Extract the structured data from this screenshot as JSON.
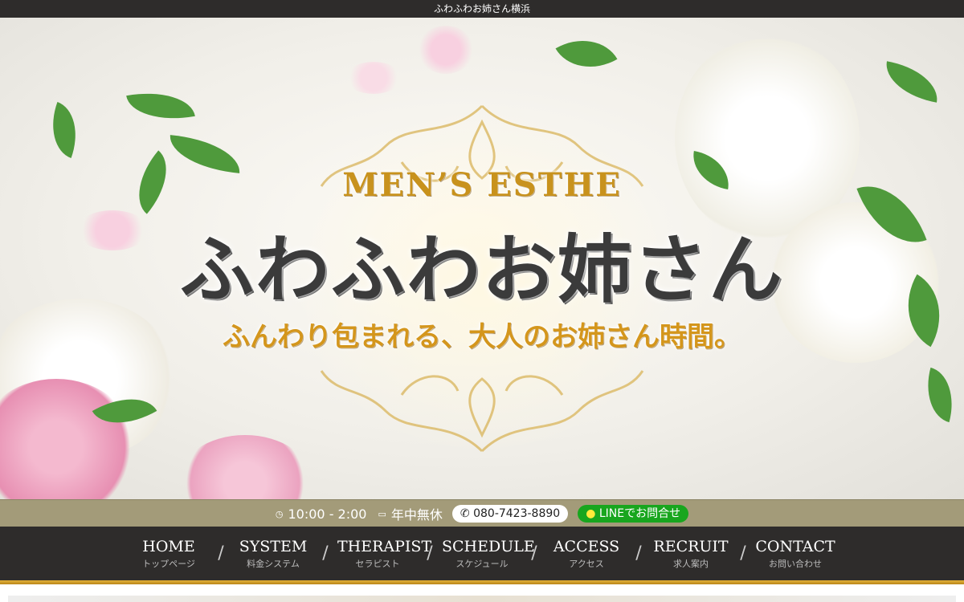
{
  "topbar": {
    "title": "ふわふわお姉さん横浜"
  },
  "hero": {
    "subtitle": "MEN’S ESTHE",
    "logo": "ふわふわお姉さん",
    "tagline": "ふんわり包まれる、大人のお姉さん時間。"
  },
  "info": {
    "hours": "10:00 - 2:00",
    "holiday": "年中無休",
    "tel": "080-7423-8890",
    "line": "LINEでお問合せ"
  },
  "nav": [
    {
      "en": "HOME",
      "jp": "トップページ"
    },
    {
      "en": "SYSTEM",
      "jp": "料金システム"
    },
    {
      "en": "THERAPIST",
      "jp": "セラピスト"
    },
    {
      "en": "SCHEDULE",
      "jp": "スケジュール"
    },
    {
      "en": "ACCESS",
      "jp": "アクセス"
    },
    {
      "en": "RECRUIT",
      "jp": "求人案内"
    },
    {
      "en": "CONTACT",
      "jp": "お問い合わせ"
    }
  ],
  "colors": {
    "nav_bg": "#2e2c2b",
    "info_bg": "#a39b79",
    "gold": "#d4961c",
    "line_green": "#18a61e"
  }
}
